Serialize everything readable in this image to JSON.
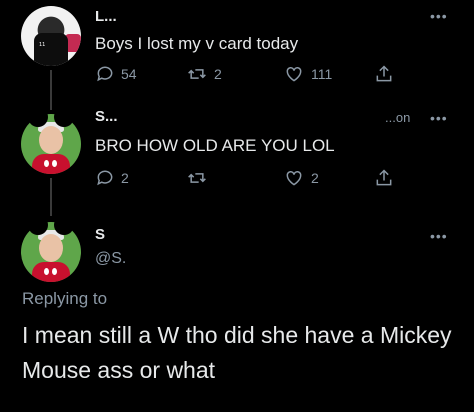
{
  "tweets": [
    {
      "name": "L...",
      "text": "Boys I lost my v card today",
      "actions": {
        "replies": "54",
        "retweets": "2",
        "likes": "111"
      }
    },
    {
      "name": "S...",
      "handle_suffix": "...on",
      "text": "BRO HOW OLD ARE YOU LOL",
      "actions": {
        "replies": "2",
        "retweets": "",
        "likes": "2"
      }
    }
  ],
  "main": {
    "name": "S",
    "handle": "@S.",
    "replying_label": "Replying to",
    "text": "I mean still a W tho did she have a Mickey Mouse ass or what"
  },
  "more_glyph": "•••"
}
